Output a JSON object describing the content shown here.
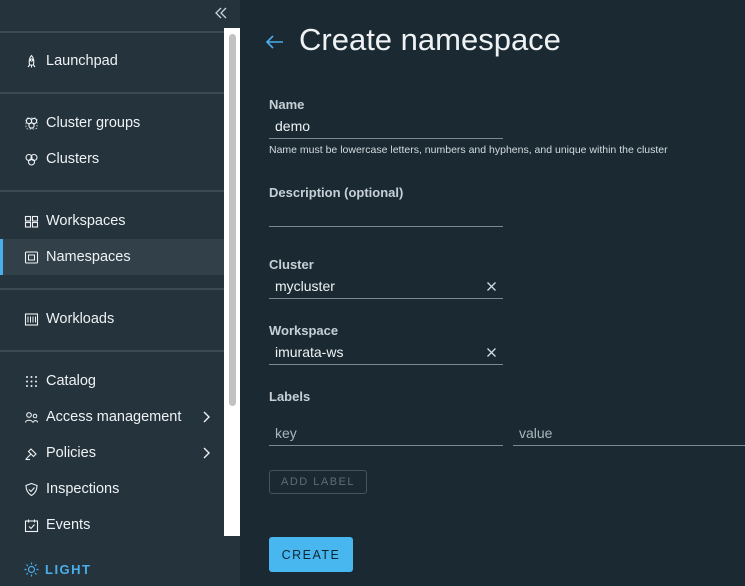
{
  "sidebar": {
    "items": [
      {
        "label": "Launchpad",
        "icon": "rocket-icon"
      },
      {
        "label": "Cluster groups",
        "icon": "cluster-groups-icon"
      },
      {
        "label": "Clusters",
        "icon": "clusters-icon"
      },
      {
        "label": "Workspaces",
        "icon": "workspaces-icon"
      },
      {
        "label": "Namespaces",
        "icon": "namespaces-icon",
        "active": true
      },
      {
        "label": "Workloads",
        "icon": "workloads-icon"
      },
      {
        "label": "Catalog",
        "icon": "catalog-icon"
      },
      {
        "label": "Access management",
        "icon": "access-icon",
        "has_submenu": true
      },
      {
        "label": "Policies",
        "icon": "policies-icon",
        "has_submenu": true
      },
      {
        "label": "Inspections",
        "icon": "shield-icon"
      },
      {
        "label": "Events",
        "icon": "calendar-icon"
      }
    ],
    "theme_toggle": "LIGHT"
  },
  "page": {
    "title": "Create namespace"
  },
  "form": {
    "name": {
      "label": "Name",
      "value": "demo",
      "helper": "Name must be lowercase letters, numbers and hyphens, and unique within the cluster"
    },
    "description": {
      "label": "Description (optional)",
      "value": ""
    },
    "cluster": {
      "label": "Cluster",
      "value": "mycluster"
    },
    "workspace": {
      "label": "Workspace",
      "value": "imurata-ws"
    },
    "labels": {
      "label": "Labels",
      "key_placeholder": "key",
      "value_placeholder": "value",
      "add_label": "ADD LABEL"
    },
    "create": "CREATE"
  },
  "colors": {
    "accent": "#49aeea",
    "primary_button": "#49b7ef",
    "sidebar_bg": "#25333d",
    "main_bg": "#1b2a32"
  }
}
